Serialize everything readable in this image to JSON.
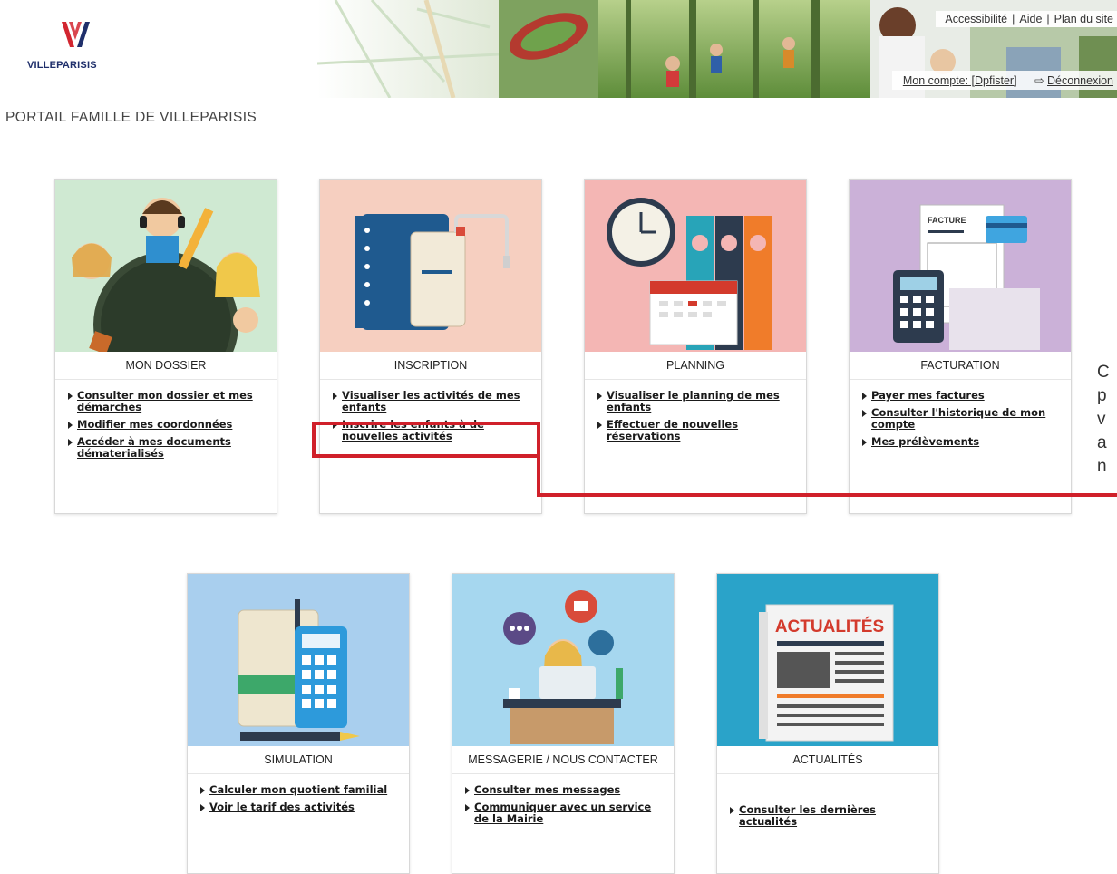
{
  "header": {
    "logo_text": "VILLEPARISIS",
    "top_links": [
      "Accessibilité",
      "Aide",
      "Plan du site"
    ],
    "separator": "|",
    "account_link": "Mon compte: [Dpfister]",
    "logout_link": "Déconnexion"
  },
  "portal_title": "PORTAIL FAMILLE DE VILLEPARISIS",
  "cards": [
    {
      "title": "MON DOSSIER",
      "links": [
        "Consulter mon dossier et mes démarches",
        "Modifier mes coordonnées",
        "Accéder à mes documents dématerialisés"
      ]
    },
    {
      "title": "INSCRIPTION",
      "links": [
        "Visualiser les activités de mes enfants",
        "Inscrire les enfants à de nouvelles activités"
      ]
    },
    {
      "title": "PLANNING",
      "links": [
        "Visualiser le planning de mes enfants",
        "Effectuer de nouvelles réservations"
      ]
    },
    {
      "title": "FACTURATION",
      "links": [
        "Payer mes factures",
        "Consulter l'historique de mon compte",
        "Mes prélèvements"
      ]
    },
    {
      "title": "SIMULATION",
      "links": [
        "Calculer mon quotient familial",
        "Voir le tarif des activités"
      ]
    },
    {
      "title": "MESSAGERIE / NOUS CONTACTER",
      "links": [
        "Consulter mes messages",
        "Communiquer avec un service de la Mairie"
      ]
    },
    {
      "title": "ACTUALITÉS",
      "links": [
        "Consulter les dernières actualités"
      ]
    }
  ],
  "image_text": {
    "facture": "FACTURE",
    "actualites": "ACTUALITÉS"
  },
  "side_note_letters": [
    "C",
    "p",
    "v",
    "a",
    "n"
  ],
  "colors": {
    "annotation_red": "#d0202a",
    "logo_red": "#d22630",
    "logo_blue": "#1f2f6b"
  }
}
